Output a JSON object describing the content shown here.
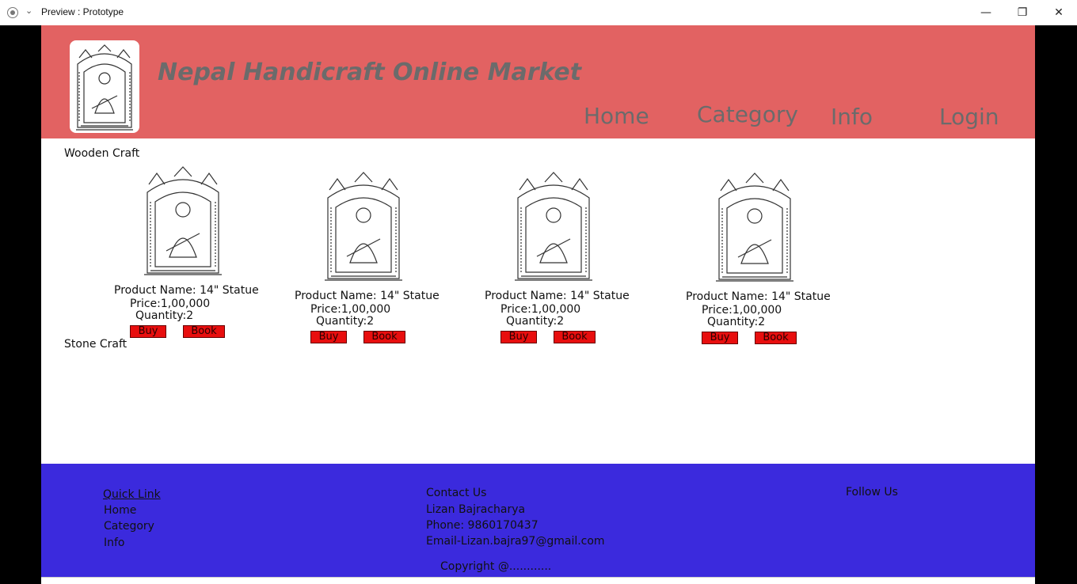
{
  "window": {
    "title": "Preview : Prototype",
    "minimize": "—",
    "maximize": "❐",
    "close": "✕"
  },
  "header": {
    "title": "Nepal Handicraft Online Market",
    "nav": [
      "Home",
      "Category",
      "Info",
      "Login"
    ],
    "bg_color": "#e26262"
  },
  "sections": {
    "wooden": "Wooden Craft",
    "stone": "Stone Craft"
  },
  "products": [
    {
      "name": "Product Name: 14\" Statue",
      "price": "Price:1,00,000",
      "quantity": "Quantity:2",
      "buy": "Buy",
      "book": "Book"
    },
    {
      "name": "Product Name: 14\" Statue",
      "price": "Price:1,00,000",
      "quantity": "Quantity:2",
      "buy": "Buy",
      "book": "Book"
    },
    {
      "name": "Product Name: 14\" Statue",
      "price": "Price:1,00,000",
      "quantity": "Quantity:2",
      "buy": "Buy",
      "book": "Book"
    },
    {
      "name": "Product Name: 14\" Statue",
      "price": "Price:1,00,000",
      "quantity": "Quantity:2",
      "buy": "Buy",
      "book": "Book"
    }
  ],
  "footer": {
    "quick_link": "Quick Link",
    "links": [
      "Home",
      "Category",
      "Info"
    ],
    "contact_title": "Contact Us",
    "contact_name": "Lizan Bajracharya",
    "phone": "Phone: 9860170437",
    "email": "Email-Lizan.bajra97@gmail.com",
    "copyright": "Copyright @............",
    "follow": "Follow Us",
    "bg_color": "#3b2add"
  }
}
